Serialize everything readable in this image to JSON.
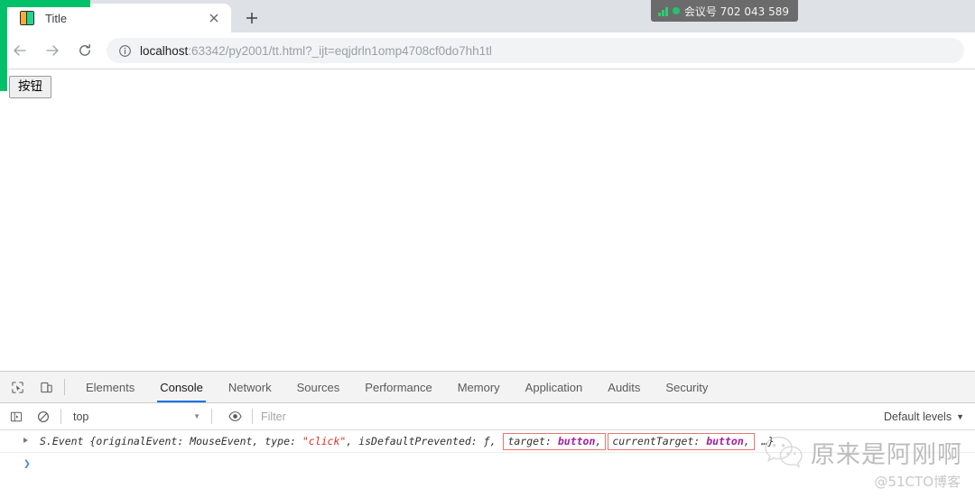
{
  "browser": {
    "tab": {
      "title": "Title",
      "favicon": "pycharm-icon",
      "close_label": "×"
    },
    "new_tab_label": "+",
    "nav": {
      "back": "back-arrow-icon",
      "forward": "forward-arrow-icon",
      "reload": "reload-icon"
    },
    "omnibox": {
      "info_icon": "info-circle-icon",
      "host": "localhost",
      "path": ":63342/py2001/tt.html?_ijt=eqjdrln1omp4708cf0do7hh1tl",
      "full_url": "localhost:63342/py2001/tt.html?_ijt=eqjdrln1omp4708cf0do7hh1tl"
    }
  },
  "overlay": {
    "meeting_label": "会议号",
    "meeting_id": "702 043 589",
    "meeting_full": "会议号 702 043 589",
    "share_border_color": "#00c06a",
    "badge_color": "#6b6b6b"
  },
  "page": {
    "button_label": "按钮"
  },
  "devtools": {
    "inspect_icon": "inspect-element-icon",
    "device_icon": "device-toolbar-icon",
    "tabs": [
      {
        "label": "Elements",
        "active": false
      },
      {
        "label": "Console",
        "active": true
      },
      {
        "label": "Network",
        "active": false
      },
      {
        "label": "Sources",
        "active": false
      },
      {
        "label": "Performance",
        "active": false
      },
      {
        "label": "Memory",
        "active": false
      },
      {
        "label": "Application",
        "active": false
      },
      {
        "label": "Audits",
        "active": false
      },
      {
        "label": "Security",
        "active": false
      }
    ],
    "console_toolbar": {
      "sidebar_icon": "console-sidebar-icon",
      "clear_icon": "clear-console-icon",
      "context": "top",
      "context_caret": "▼",
      "eye_icon": "live-expression-icon",
      "filter_placeholder": "Filter",
      "filter_value": "",
      "levels_label": "Default levels",
      "levels_caret": "▼"
    },
    "console_log": {
      "prefix": "S.Event",
      "open_brace": "{",
      "part_original": "originalEvent: MouseEvent,",
      "part_type_key": "type:",
      "part_type_val": "\"click\"",
      "part_prevented": ", isDefaultPrevented: ƒ,",
      "hl_target_key": "target:",
      "hl_target_val": "button",
      "hl_target_comma": ",",
      "hl_current_key": "currentTarget:",
      "hl_current_val": "button",
      "hl_current_comma": ",",
      "suffix": "…}",
      "highlight_color": "#e8766f",
      "string_color": "#d93025",
      "node_color": "#a020a0"
    },
    "prompt_caret": "❯"
  },
  "watermark": {
    "logo": "wechat-logo",
    "name": "原来是阿刚啊",
    "subtitle": "@51CTO博客"
  }
}
